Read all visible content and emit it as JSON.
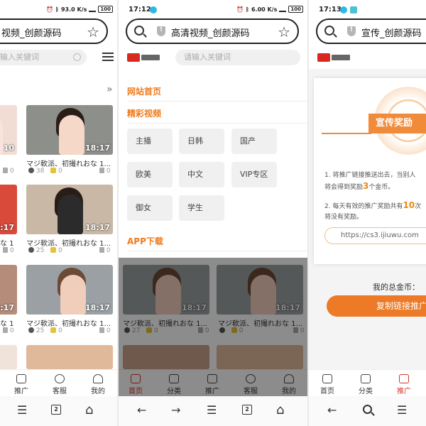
{
  "colors": {
    "accent": "#f07b1b",
    "active_nav": "#d6342b",
    "coin_highlight": "#e78a16"
  },
  "left": {
    "status": {
      "network": "93.0 K/s",
      "battery": "100"
    },
    "url": "视频_创颜源码",
    "search_placeholder": "输入关键词",
    "chevron": "»",
    "videos": [
      {
        "title": "",
        "duration": "10",
        "likes": "0"
      },
      {
        "title": "マジ軟派、初撮れおな 1...",
        "duration": "18:17",
        "plays": "38",
        "coins": "0",
        "likes": "0"
      },
      {
        "title": "な 1",
        "duration": "8:17",
        "likes": "0"
      },
      {
        "title": "マジ軟派、初撮れおな 1...",
        "duration": "18:17",
        "plays": "25",
        "coins": "0",
        "likes": "0"
      },
      {
        "title": "な 1",
        "duration": "8:17",
        "likes": "0"
      },
      {
        "title": "マジ軟派、初撮れおな 1...",
        "duration": "18:17",
        "plays": "25",
        "coins": "0",
        "likes": "0"
      }
    ],
    "nav": [
      {
        "label": "推广"
      },
      {
        "label": "客服"
      },
      {
        "label": "我的"
      }
    ],
    "sys": {
      "menu": "☰",
      "tabs": "2",
      "home": "⌂"
    }
  },
  "mid": {
    "status": {
      "time": "17:12",
      "network": "6.00 K/s",
      "battery": "100"
    },
    "url": "高清视频_创颜源码",
    "search_placeholder": "请输入关键词",
    "menu": {
      "home": "网站首页",
      "featured": "精彩视频",
      "categories": [
        "主播",
        "日韩",
        "国产",
        "欧美",
        "中文",
        "VIP专区",
        "御女",
        "学生"
      ],
      "app": "APP下载"
    },
    "videos": [
      {
        "title": "マジ軟派、初撮れおな 1...",
        "duration": "18:17",
        "plays": "27",
        "coins": "0",
        "likes": "0"
      },
      {
        "title": "マジ軟派、初撮れおな 1...",
        "duration": "18:17",
        "plays": "",
        "coins": "0",
        "likes": "0"
      }
    ],
    "nav": [
      {
        "label": "首页"
      },
      {
        "label": "分类"
      },
      {
        "label": "推广"
      },
      {
        "label": "客服"
      },
      {
        "label": "我的"
      }
    ],
    "sys": {
      "back": "←",
      "forward": "→",
      "menu": "☰",
      "tabs": "2",
      "home": "⌂"
    }
  },
  "right": {
    "status": {
      "time": "17:13"
    },
    "url": "宣传_创颜源码",
    "banner": "宣传奖励",
    "rule1_a": "1. 将推广链接推送出去，当别人",
    "rule1_b_pre": "将会得到奖励",
    "rule1_b_num": "3",
    "rule1_b_post": "个金币。",
    "rule2_a_pre": "2. 每天有效的推广奖励共有",
    "rule2_a_num": "10",
    "rule2_a_post": "次",
    "rule2_b": "将没有奖励。",
    "link": "https://cs3.ijiuwu.com",
    "coins_label": "我的总金币：",
    "copy_button": "复制链接推广",
    "nav": [
      {
        "label": "首页"
      },
      {
        "label": "分类"
      },
      {
        "label": "推广"
      }
    ],
    "sys": {
      "back": "←",
      "search": "search",
      "menu": "☰"
    }
  }
}
